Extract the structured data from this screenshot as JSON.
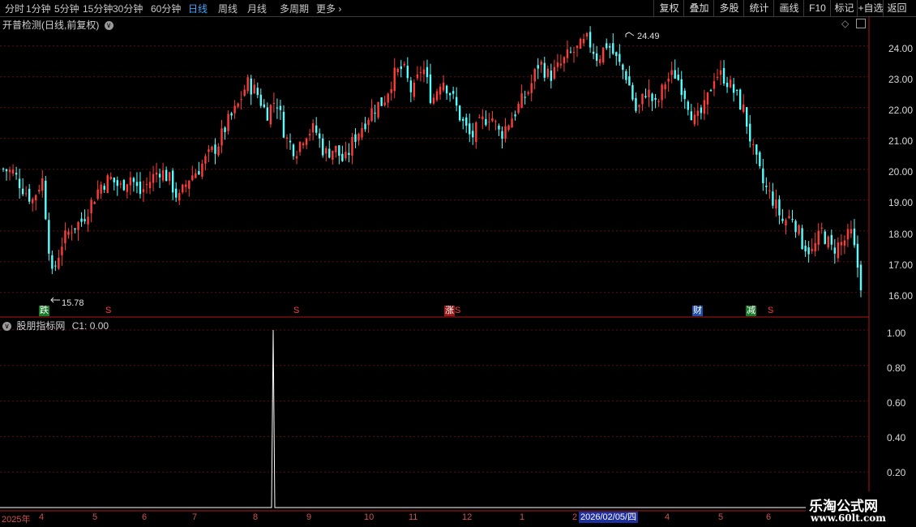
{
  "toolbar": {
    "periods": [
      "分时",
      "1分钟",
      "5分钟",
      "15分钟",
      "30分钟",
      "60分钟",
      "日线",
      "周线",
      "月线",
      "多周期",
      "更多"
    ],
    "active_period": "日线",
    "right_buttons": [
      "复权",
      "叠加",
      "多股",
      "统计",
      "画线",
      "F10",
      "标记",
      "+自选",
      "返回"
    ]
  },
  "main_panel": {
    "title": "开普检测(日线,前复权)",
    "high_label": "24.49",
    "low_label": "15.78",
    "signals": [
      {
        "text": "跌",
        "kind": "green"
      },
      {
        "text": "S",
        "kind": "s"
      },
      {
        "text": "S",
        "kind": "s"
      },
      {
        "text": "涨",
        "kind": "red"
      },
      {
        "text": "S",
        "kind": "s"
      },
      {
        "text": "财",
        "kind": "blue"
      },
      {
        "text": "减",
        "kind": "green"
      },
      {
        "text": "S",
        "kind": "s"
      }
    ],
    "y_ticks": [
      "24.00",
      "23.00",
      "22.00",
      "21.00",
      "20.00",
      "19.00",
      "18.00",
      "17.00",
      "16.00"
    ]
  },
  "indicator_panel": {
    "title": "股朋指标网",
    "value_label": "C1: 0.00",
    "y_ticks": [
      "1.00",
      "0.80",
      "0.60",
      "0.40",
      "0.20"
    ]
  },
  "x_axis": {
    "labels": [
      "2025年",
      "4",
      "5",
      "6",
      "7",
      "8",
      "9",
      "10",
      "11",
      "12",
      "1",
      "2",
      "4",
      "5",
      "6"
    ],
    "cursor_date": "2026/02/05/四"
  },
  "watermark": {
    "line1": "乐淘公式网",
    "line2": "www.60lt.com"
  },
  "colors": {
    "up": "#ff3c3c",
    "down": "#54ffff",
    "axis": "#b01818",
    "active": "#3ea7ff"
  },
  "chart_data": {
    "type": "candlestick",
    "title": "开普检测(日线,前复权)",
    "ylim": [
      15.6,
      24.7
    ],
    "y_ticks": [
      16,
      17,
      18,
      19,
      20,
      21,
      22,
      23,
      24
    ],
    "x_month_labels": [
      "2025年",
      "4",
      "5",
      "6",
      "7",
      "8",
      "9",
      "10",
      "11",
      "12",
      "1",
      "2",
      "4",
      "5",
      "6"
    ],
    "annotations": {
      "high": 24.49,
      "low": 15.78
    },
    "close_path": [
      20.0,
      19.9,
      19.4,
      19.0,
      19.7,
      16.5,
      17.6,
      18.1,
      18.3,
      18.9,
      19.5,
      19.7,
      19.4,
      19.8,
      19.2,
      19.6,
      20.0,
      19.7,
      19.0,
      19.7,
      20.0,
      20.4,
      20.8,
      21.5,
      22.0,
      22.8,
      22.5,
      21.8,
      22.3,
      21.0,
      20.6,
      21.2,
      21.3,
      20.5,
      20.7,
      20.2,
      21.0,
      21.5,
      22.0,
      22.2,
      23.0,
      23.3,
      22.4,
      23.4,
      22.2,
      23.0,
      22.4,
      21.6,
      21.0,
      21.5,
      21.8,
      21.1,
      21.6,
      22.1,
      22.6,
      23.5,
      23.0,
      23.3,
      23.7,
      23.9,
      24.2,
      23.6,
      24.1,
      23.5,
      23.0,
      21.8,
      22.6,
      22.0,
      22.9,
      23.1,
      22.4,
      21.5,
      22.0,
      23.1,
      23.0,
      22.5,
      21.9,
      20.5,
      19.5,
      19.0,
      18.3,
      18.5,
      17.6,
      17.3,
      18.0,
      17.4,
      17.6,
      17.9,
      16.3
    ],
    "indicator": {
      "name": "股朋指标网",
      "series": "C1",
      "ylim": [
        0,
        1.05
      ],
      "y_ticks": [
        0.2,
        0.4,
        0.6,
        0.8,
        1.0
      ],
      "spike_value": 1.0,
      "spike_month": "8"
    }
  }
}
